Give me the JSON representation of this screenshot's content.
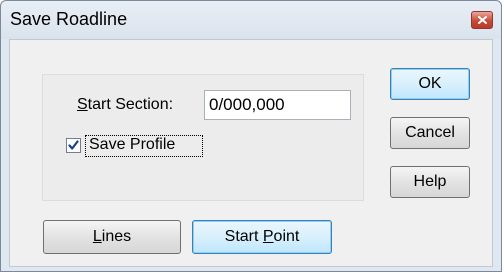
{
  "window": {
    "title": "Save Roadline"
  },
  "form": {
    "start_section_label_first": "S",
    "start_section_label_rest": "tart Section:",
    "start_section_value": "0/000,000",
    "save_profile_checked": true,
    "save_profile_label": "Save Profile"
  },
  "buttons": {
    "ok_label": "OK",
    "cancel_label": "Cancel",
    "help_label": "Help",
    "lines_label_first": "L",
    "lines_label_rest": "ines",
    "start_point_label_a": "Start ",
    "start_point_label_b": "P",
    "start_point_label_c": "oint"
  }
}
